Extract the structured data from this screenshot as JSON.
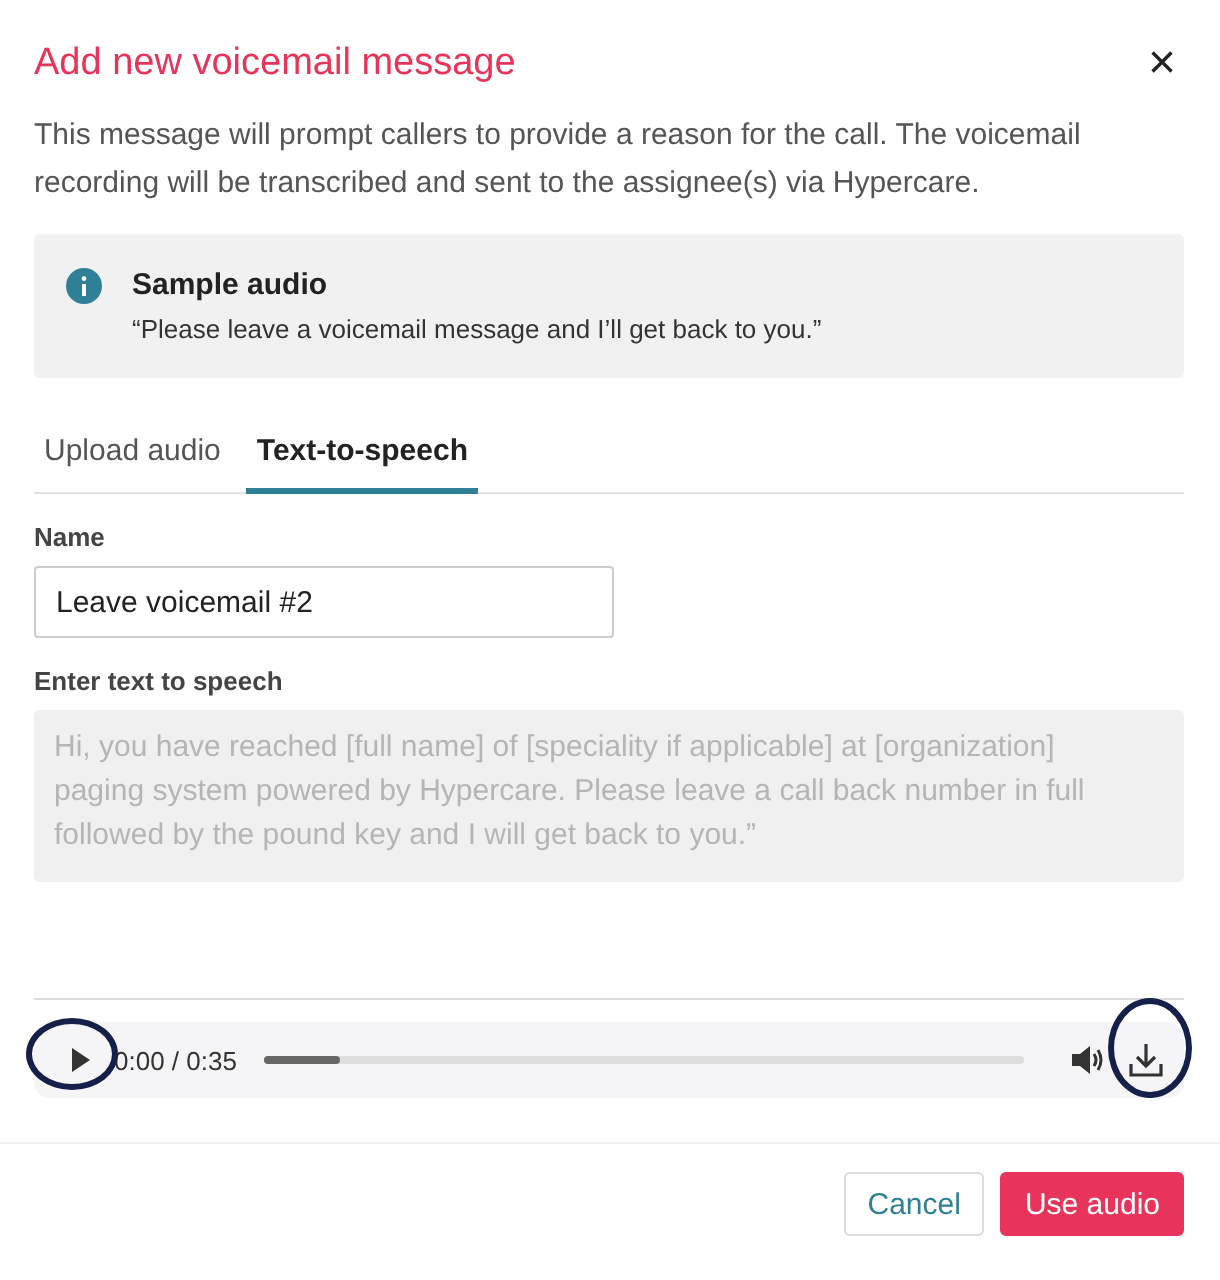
{
  "dialog": {
    "title": "Add new voicemail message",
    "close": "×",
    "description": "This message will prompt callers to provide a reason for the call. The voicemail recording will be transcribed and sent to the assignee(s) via Hypercare."
  },
  "info": {
    "title": "Sample audio",
    "text": "“Please leave a voicemail message and I’ll get back to you.”"
  },
  "tabs": [
    {
      "label": "Upload audio",
      "selected": false
    },
    {
      "label": "Text-to-speech",
      "selected": true
    }
  ],
  "name_field": {
    "label": "Name",
    "value": "Leave voicemail #2"
  },
  "speech_field": {
    "label": "Enter text to speech",
    "placeholder": "Hi, you have reached [full name] of [speciality if applicable] at [organization] paging system powered by Hypercare. Please leave a call back number in full followed by the pound key and I will get back to you.”"
  },
  "player": {
    "time": "0:00 / 0:35",
    "level": 0.1,
    "play_highlighted": true,
    "download_highlighted": true
  },
  "buttons": [
    {
      "label": "Cancel",
      "kind": "secondary"
    },
    {
      "label": "Use audio",
      "kind": "primary"
    }
  ]
}
